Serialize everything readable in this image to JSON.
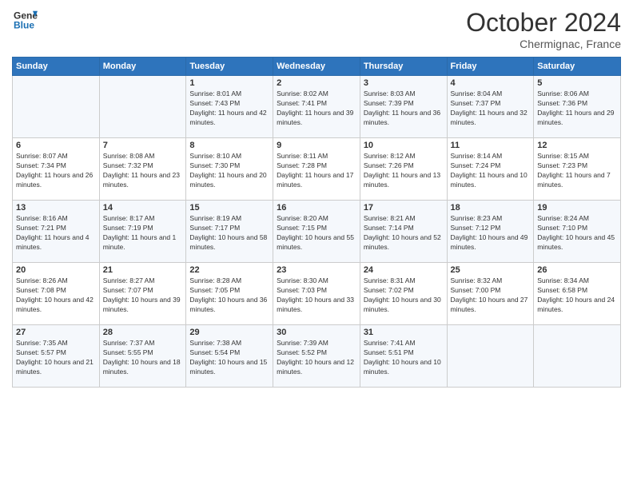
{
  "logo": {
    "line1": "General",
    "line2": "Blue"
  },
  "title": "October 2024",
  "subtitle": "Chermignac, France",
  "days_of_week": [
    "Sunday",
    "Monday",
    "Tuesday",
    "Wednesday",
    "Thursday",
    "Friday",
    "Saturday"
  ],
  "weeks": [
    [
      {
        "day": "",
        "sunrise": "",
        "sunset": "",
        "daylight": ""
      },
      {
        "day": "",
        "sunrise": "",
        "sunset": "",
        "daylight": ""
      },
      {
        "day": "1",
        "sunrise": "Sunrise: 8:01 AM",
        "sunset": "Sunset: 7:43 PM",
        "daylight": "Daylight: 11 hours and 42 minutes."
      },
      {
        "day": "2",
        "sunrise": "Sunrise: 8:02 AM",
        "sunset": "Sunset: 7:41 PM",
        "daylight": "Daylight: 11 hours and 39 minutes."
      },
      {
        "day": "3",
        "sunrise": "Sunrise: 8:03 AM",
        "sunset": "Sunset: 7:39 PM",
        "daylight": "Daylight: 11 hours and 36 minutes."
      },
      {
        "day": "4",
        "sunrise": "Sunrise: 8:04 AM",
        "sunset": "Sunset: 7:37 PM",
        "daylight": "Daylight: 11 hours and 32 minutes."
      },
      {
        "day": "5",
        "sunrise": "Sunrise: 8:06 AM",
        "sunset": "Sunset: 7:36 PM",
        "daylight": "Daylight: 11 hours and 29 minutes."
      }
    ],
    [
      {
        "day": "6",
        "sunrise": "Sunrise: 8:07 AM",
        "sunset": "Sunset: 7:34 PM",
        "daylight": "Daylight: 11 hours and 26 minutes."
      },
      {
        "day": "7",
        "sunrise": "Sunrise: 8:08 AM",
        "sunset": "Sunset: 7:32 PM",
        "daylight": "Daylight: 11 hours and 23 minutes."
      },
      {
        "day": "8",
        "sunrise": "Sunrise: 8:10 AM",
        "sunset": "Sunset: 7:30 PM",
        "daylight": "Daylight: 11 hours and 20 minutes."
      },
      {
        "day": "9",
        "sunrise": "Sunrise: 8:11 AM",
        "sunset": "Sunset: 7:28 PM",
        "daylight": "Daylight: 11 hours and 17 minutes."
      },
      {
        "day": "10",
        "sunrise": "Sunrise: 8:12 AM",
        "sunset": "Sunset: 7:26 PM",
        "daylight": "Daylight: 11 hours and 13 minutes."
      },
      {
        "day": "11",
        "sunrise": "Sunrise: 8:14 AM",
        "sunset": "Sunset: 7:24 PM",
        "daylight": "Daylight: 11 hours and 10 minutes."
      },
      {
        "day": "12",
        "sunrise": "Sunrise: 8:15 AM",
        "sunset": "Sunset: 7:23 PM",
        "daylight": "Daylight: 11 hours and 7 minutes."
      }
    ],
    [
      {
        "day": "13",
        "sunrise": "Sunrise: 8:16 AM",
        "sunset": "Sunset: 7:21 PM",
        "daylight": "Daylight: 11 hours and 4 minutes."
      },
      {
        "day": "14",
        "sunrise": "Sunrise: 8:17 AM",
        "sunset": "Sunset: 7:19 PM",
        "daylight": "Daylight: 11 hours and 1 minute."
      },
      {
        "day": "15",
        "sunrise": "Sunrise: 8:19 AM",
        "sunset": "Sunset: 7:17 PM",
        "daylight": "Daylight: 10 hours and 58 minutes."
      },
      {
        "day": "16",
        "sunrise": "Sunrise: 8:20 AM",
        "sunset": "Sunset: 7:15 PM",
        "daylight": "Daylight: 10 hours and 55 minutes."
      },
      {
        "day": "17",
        "sunrise": "Sunrise: 8:21 AM",
        "sunset": "Sunset: 7:14 PM",
        "daylight": "Daylight: 10 hours and 52 minutes."
      },
      {
        "day": "18",
        "sunrise": "Sunrise: 8:23 AM",
        "sunset": "Sunset: 7:12 PM",
        "daylight": "Daylight: 10 hours and 49 minutes."
      },
      {
        "day": "19",
        "sunrise": "Sunrise: 8:24 AM",
        "sunset": "Sunset: 7:10 PM",
        "daylight": "Daylight: 10 hours and 45 minutes."
      }
    ],
    [
      {
        "day": "20",
        "sunrise": "Sunrise: 8:26 AM",
        "sunset": "Sunset: 7:08 PM",
        "daylight": "Daylight: 10 hours and 42 minutes."
      },
      {
        "day": "21",
        "sunrise": "Sunrise: 8:27 AM",
        "sunset": "Sunset: 7:07 PM",
        "daylight": "Daylight: 10 hours and 39 minutes."
      },
      {
        "day": "22",
        "sunrise": "Sunrise: 8:28 AM",
        "sunset": "Sunset: 7:05 PM",
        "daylight": "Daylight: 10 hours and 36 minutes."
      },
      {
        "day": "23",
        "sunrise": "Sunrise: 8:30 AM",
        "sunset": "Sunset: 7:03 PM",
        "daylight": "Daylight: 10 hours and 33 minutes."
      },
      {
        "day": "24",
        "sunrise": "Sunrise: 8:31 AM",
        "sunset": "Sunset: 7:02 PM",
        "daylight": "Daylight: 10 hours and 30 minutes."
      },
      {
        "day": "25",
        "sunrise": "Sunrise: 8:32 AM",
        "sunset": "Sunset: 7:00 PM",
        "daylight": "Daylight: 10 hours and 27 minutes."
      },
      {
        "day": "26",
        "sunrise": "Sunrise: 8:34 AM",
        "sunset": "Sunset: 6:58 PM",
        "daylight": "Daylight: 10 hours and 24 minutes."
      }
    ],
    [
      {
        "day": "27",
        "sunrise": "Sunrise: 7:35 AM",
        "sunset": "Sunset: 5:57 PM",
        "daylight": "Daylight: 10 hours and 21 minutes."
      },
      {
        "day": "28",
        "sunrise": "Sunrise: 7:37 AM",
        "sunset": "Sunset: 5:55 PM",
        "daylight": "Daylight: 10 hours and 18 minutes."
      },
      {
        "day": "29",
        "sunrise": "Sunrise: 7:38 AM",
        "sunset": "Sunset: 5:54 PM",
        "daylight": "Daylight: 10 hours and 15 minutes."
      },
      {
        "day": "30",
        "sunrise": "Sunrise: 7:39 AM",
        "sunset": "Sunset: 5:52 PM",
        "daylight": "Daylight: 10 hours and 12 minutes."
      },
      {
        "day": "31",
        "sunrise": "Sunrise: 7:41 AM",
        "sunset": "Sunset: 5:51 PM",
        "daylight": "Daylight: 10 hours and 10 minutes."
      },
      {
        "day": "",
        "sunrise": "",
        "sunset": "",
        "daylight": ""
      },
      {
        "day": "",
        "sunrise": "",
        "sunset": "",
        "daylight": ""
      }
    ]
  ]
}
